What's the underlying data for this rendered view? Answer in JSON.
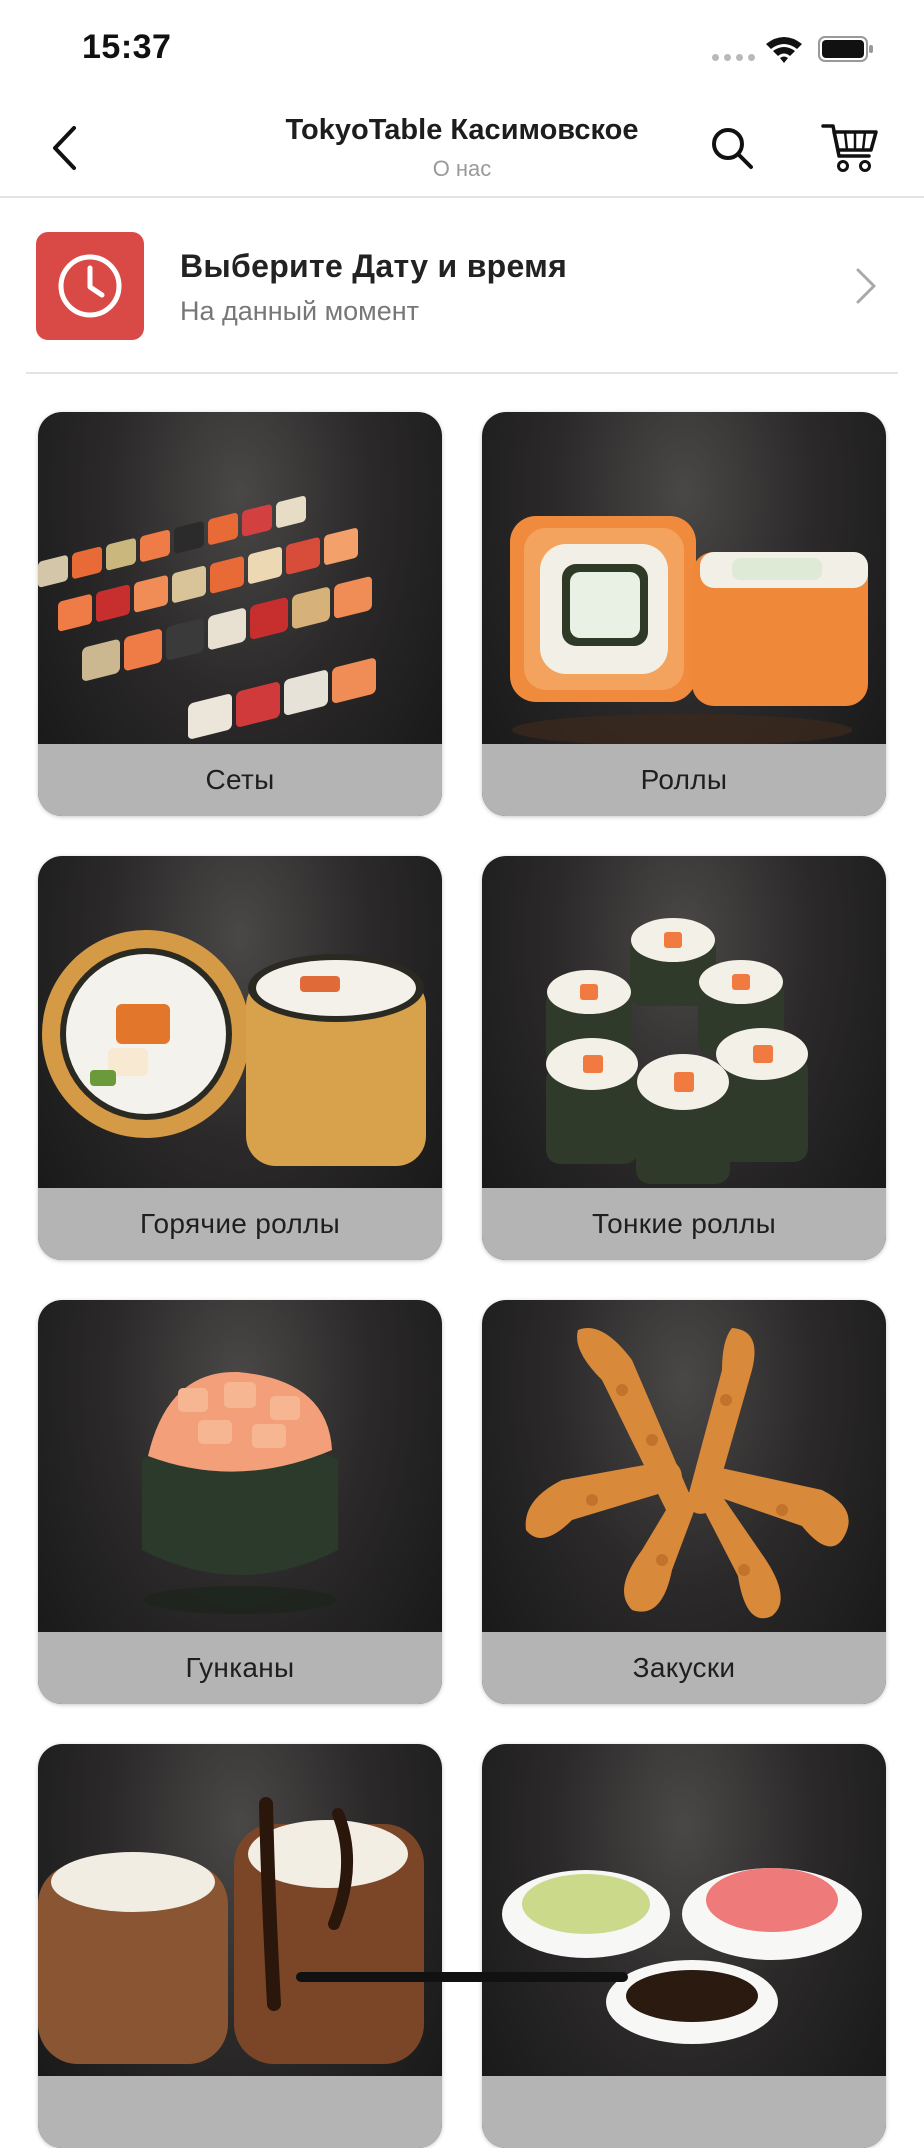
{
  "status_bar": {
    "time": "15:37"
  },
  "header": {
    "title": "TokyoTable Касимовское",
    "subtitle": "О нас",
    "back_icon": "chevron-left-icon",
    "search_icon": "search-icon",
    "cart_icon": "cart-icon"
  },
  "datetime": {
    "title": "Выберите Дату и время",
    "subtitle": "На данный момент",
    "icon": "clock-icon",
    "accent_color": "#d94a47"
  },
  "categories": [
    {
      "label": "Сеты"
    },
    {
      "label": "Роллы"
    },
    {
      "label": "Горячие роллы"
    },
    {
      "label": "Тонкие роллы"
    },
    {
      "label": "Гунканы"
    },
    {
      "label": "Закуски"
    },
    {
      "label": ""
    },
    {
      "label": ""
    }
  ]
}
